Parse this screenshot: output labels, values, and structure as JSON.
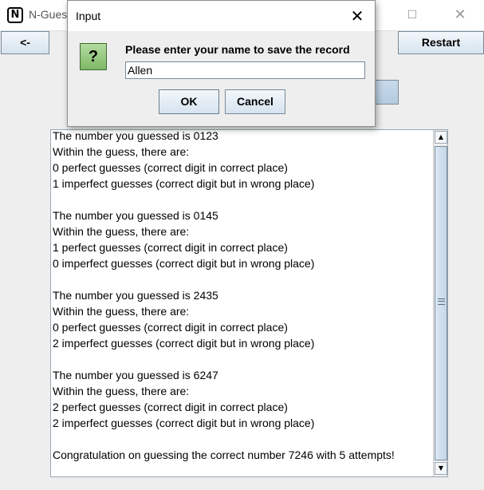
{
  "window": {
    "title": "N-Guess",
    "app_icon_letter": "N",
    "maximize_glyph": "☐",
    "close_glyph": "✕"
  },
  "toolbar": {
    "back_label": "<-",
    "restart_label": "Restart"
  },
  "log": {
    "lines": [
      "The number you guessed is 0123",
      "Within the guess, there are:",
      "0 perfect guesses (correct digit in correct place)",
      "1 imperfect guesses (correct digit but in wrong place)",
      "",
      "The number you guessed is 0145",
      "Within the guess, there are:",
      "1 perfect guesses (correct digit in correct place)",
      "0 imperfect guesses (correct digit but in wrong place)",
      "",
      "The number you guessed is 2435",
      "Within the guess, there are:",
      "0 perfect guesses (correct digit in correct place)",
      "2 imperfect guesses (correct digit but in wrong place)",
      "",
      "The number you guessed is 6247",
      "Within the guess, there are:",
      "2 perfect guesses (correct digit in correct place)",
      "2 imperfect guesses (correct digit but in wrong place)",
      "",
      "Congratulation on guessing the correct number 7246 with 5 attempts!"
    ],
    "scroll_up_glyph": "▲",
    "scroll_down_glyph": "▼"
  },
  "dialog": {
    "title": "Input",
    "close_glyph": "✕",
    "icon_glyph": "?",
    "icon_name": "question-icon",
    "message": "Please enter your name to save the record",
    "input_value": "Allen",
    "ok_label": "OK",
    "cancel_label": "Cancel"
  },
  "colors": {
    "button_border": "#7a8a99",
    "icon_green": "#7fb865"
  }
}
